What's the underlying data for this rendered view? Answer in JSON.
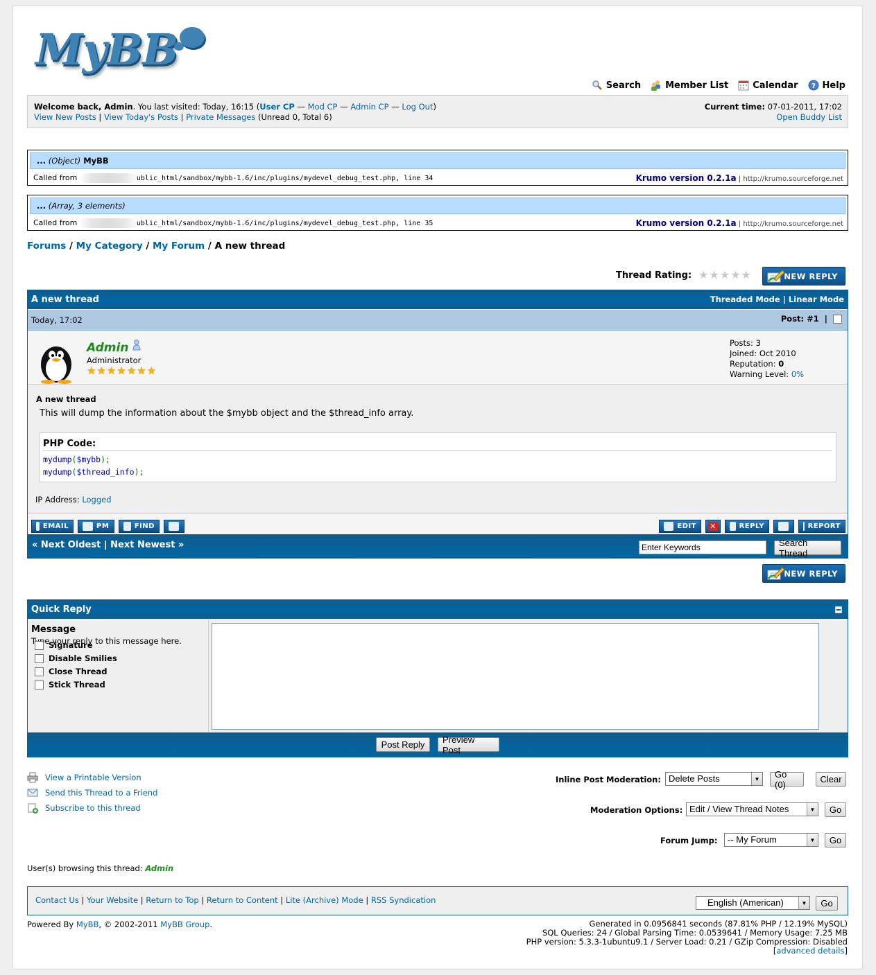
{
  "logo": {
    "text": "MyBB"
  },
  "topmenu": {
    "search": "Search",
    "members": "Member List",
    "calendar": "Calendar",
    "help": "Help"
  },
  "welcome": {
    "welcome_prefix": "Welcome back, ",
    "username": "Admin",
    "last_visited": ". You last visited: Today, 16:15 (",
    "user_cp": "User CP",
    "dash1": " — ",
    "mod_cp": "Mod CP",
    "dash2": " — ",
    "admin_cp": "Admin CP",
    "dash3": " — ",
    "logout": "Log Out",
    "close_paren": ")",
    "view_new": "View New Posts",
    "view_today": "View Today's Posts",
    "pm": "Private Messages",
    "pm_counts": " (Unread 0, Total 6)",
    "sep": " | ",
    "current_time_label": "Current time:",
    "current_time": " 07-01-2011, 17:02",
    "buddy_list": "Open Buddy List"
  },
  "krumo": [
    {
      "dots": "...",
      "type": "(Object)",
      "name": " MyBB",
      "called_from": "Called from ",
      "path": "ublic_html/sandbox/mybb-1.6/inc/plugins/mydevel_debug_test.php",
      "line": ", line 34",
      "version": "Krumo version 0.2.1a",
      "site": " | http://krumo.sourceforge.net"
    },
    {
      "dots": "...",
      "type": "(Array, 3 elements)",
      "name": "",
      "called_from": "Called from ",
      "path": "ublic_html/sandbox/mybb-1.6/inc/plugins/mydevel_debug_test.php",
      "line": ", line 35",
      "version": "Krumo version 0.2.1a",
      "site": " | http://krumo.sourceforge.net"
    }
  ],
  "breadcrumb": {
    "forums": "Forums",
    "category": "My Category",
    "forum": "My Forum",
    "current": "A new thread",
    "sep": " / "
  },
  "rating": {
    "label": "Thread Rating:",
    "stars": 5,
    "value": 0
  },
  "new_reply": "NEW REPLY",
  "thread": {
    "title": "A new thread",
    "threaded_mode": "Threaded Mode",
    "linear_mode": "Linear Mode",
    "mode_sep": " | ",
    "post_date": "Today, 17:02",
    "post_number": "Post: #1",
    "post_bar": "|",
    "author": {
      "name": "Admin",
      "title": "Administrator",
      "stars": 7,
      "posts_label": "Posts: ",
      "posts": "3",
      "joined_label": "Joined: ",
      "joined": "Oct 2010",
      "reputation_label": "Reputation: ",
      "reputation": "0",
      "warning_label": "Warning Level: ",
      "warning": "0%"
    },
    "post_title": "A new thread",
    "post_text": "This will dump the information about the $mybb object and the $thread_info array.",
    "code_header": "PHP Code:",
    "code_lines": [
      {
        "fn": "mydump",
        "open": "(",
        "arg": "$mybb",
        "close": ");"
      },
      {
        "fn": "mydump",
        "open": "(",
        "arg": "$thread_info",
        "close": ");"
      }
    ],
    "ip_label": "IP Address: ",
    "ip_value": "Logged",
    "buttons": {
      "email": "EMAIL",
      "pm": "PM",
      "find": "FIND",
      "edit": "EDIT",
      "reply": "REPLY",
      "report": "REPORT"
    },
    "next_oldest": "« Next Oldest",
    "nav_sep": " | ",
    "next_newest": "Next Newest »",
    "keywords_placeholder": "Enter Keywords",
    "search_thread": "Search Thread"
  },
  "quick_reply": {
    "title": "Quick Reply",
    "message_label": "Message",
    "message_help": "Type your reply to this message here.",
    "options": [
      "Signature",
      "Disable Smilies",
      "Close Thread",
      "Stick Thread"
    ],
    "post_reply": "Post Reply",
    "preview_post": "Preview Post"
  },
  "bottom_links": {
    "printable": "View a Printable Version",
    "send_friend": "Send this Thread to a Friend",
    "subscribe": "Subscribe to this thread"
  },
  "moderation": {
    "inline_label": "Inline Post Moderation:",
    "inline_selected": "Delete Posts",
    "inline_go": "Go (0)",
    "clear": "Clear",
    "options_label": "Moderation Options:",
    "options_selected": "Edit / View Thread Notes",
    "options_go": "Go",
    "jump_label": "Forum Jump:",
    "jump_selected": "-- My Forum",
    "jump_go": "Go"
  },
  "browsing": {
    "label": "User(s) browsing this thread: ",
    "user": "Admin"
  },
  "footer": {
    "links": [
      "Contact Us",
      "Your Website",
      "Return to Top",
      "Return to Content",
      "Lite (Archive) Mode",
      "RSS Syndication"
    ],
    "language": "English (American)",
    "language_go": "Go",
    "powered_prefix": "Powered By ",
    "powered_mybb": "MyBB",
    "powered_mid": ", © 2002-2011 ",
    "powered_group": "MyBB Group",
    "powered_end": ".",
    "debug": [
      "Generated in 0.0956841 seconds (87.81% PHP / 12.19% MySQL)",
      "SQL Queries: 24 / Global Parsing Time: 0.0539641 / Memory Usage: 7.25 MB",
      "PHP version: 5.3.3-1ubuntu9.1 / Server Load: 0.21 / GZip Compression: Disabled"
    ],
    "advanced_open": "[",
    "advanced": "advanced details",
    "advanced_close": "]"
  },
  "colors": {
    "link": "#0066a2",
    "header": "#0f5c8e",
    "admin_name": "#1e8a1e",
    "krumo_header": "#b8dcff"
  }
}
